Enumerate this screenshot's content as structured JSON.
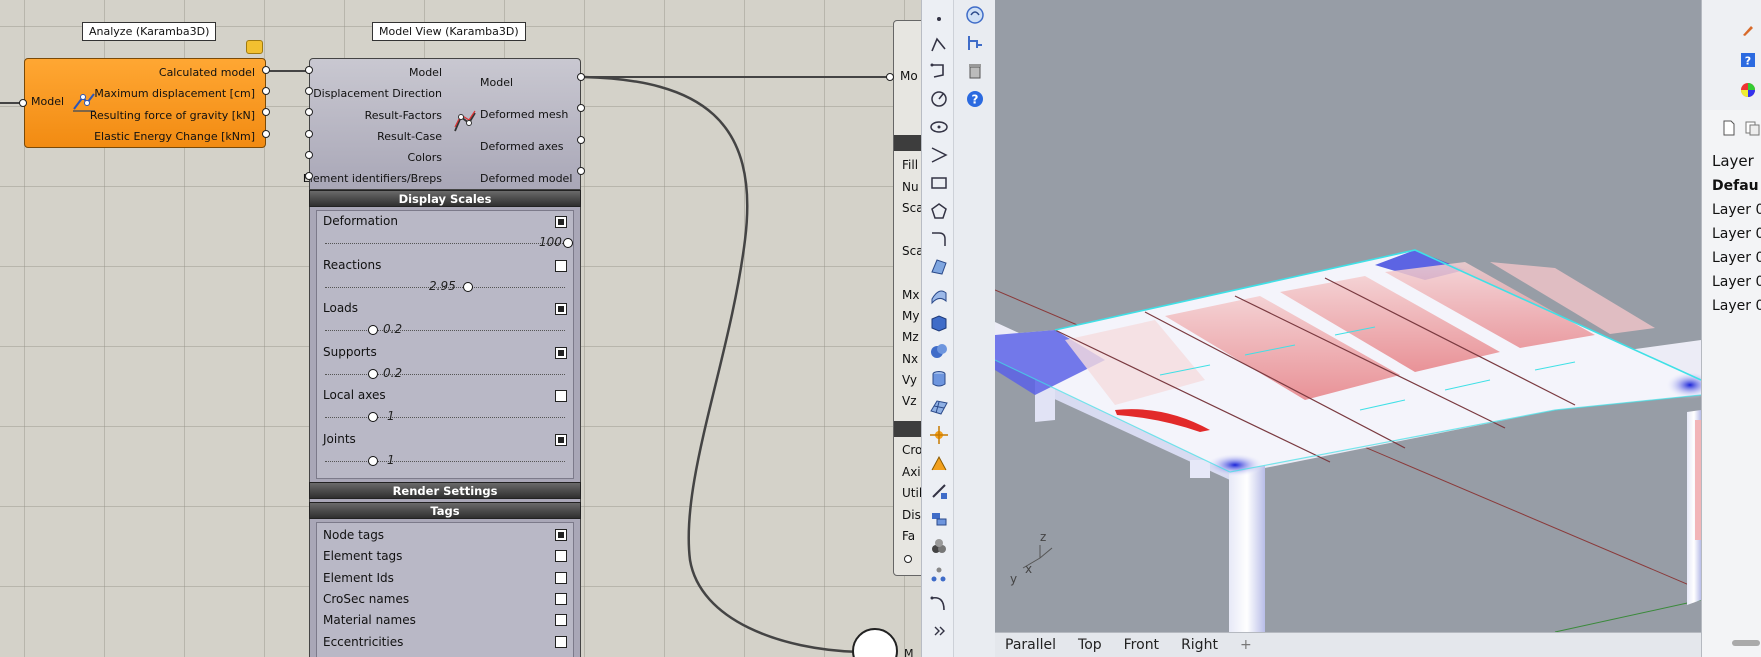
{
  "gh": {
    "analyze": {
      "title": "Analyze (Karamba3D)",
      "input": "Model",
      "outputs": [
        "Calculated model",
        "Maximum displacement [cm]",
        "Resulting force of gravity [kN]",
        "Elastic Energy Change [kNm]"
      ]
    },
    "modelview": {
      "title": "Model View (Karamba3D)",
      "inputs": [
        "Model",
        "Displacement Direction",
        "Result-Factors",
        "Result-Case",
        "Colors",
        "Element identifiers/Breps"
      ],
      "outputs": [
        "Model",
        "Deformed mesh",
        "Deformed axes",
        "Deformed model"
      ]
    },
    "display_scales": {
      "title": "Display Scales",
      "rows": [
        {
          "label": "Deformation",
          "checked": true,
          "value": "100",
          "fraction": 0.96
        },
        {
          "label": "Reactions",
          "checked": false,
          "value": "2.95",
          "fraction": 0.54
        },
        {
          "label": "Loads",
          "checked": true,
          "value": "0.2",
          "fraction": 0.18
        },
        {
          "label": "Supports",
          "checked": true,
          "value": "0.2",
          "fraction": 0.18
        },
        {
          "label": "Local axes",
          "checked": false,
          "value": "1",
          "fraction": 0.18
        },
        {
          "label": "Joints",
          "checked": true,
          "value": "1",
          "fraction": 0.18
        }
      ]
    },
    "render_settings": {
      "title": "Render Settings"
    },
    "tags": {
      "title": "Tags",
      "rows": [
        {
          "label": "Node tags",
          "checked": true
        },
        {
          "label": "Element tags",
          "checked": false
        },
        {
          "label": "Element Ids",
          "checked": false
        },
        {
          "label": "CroSec names",
          "checked": false
        },
        {
          "label": "Material names",
          "checked": false
        },
        {
          "label": "Eccentricities",
          "checked": false
        }
      ]
    },
    "side_panel": {
      "input_label": "Mo",
      "rows_a": [
        "Fill",
        "Nu",
        "Sca",
        "Sca"
      ],
      "rows_b": [
        "Mx",
        "My",
        "Mz",
        "Nx",
        "Vy",
        "Vz"
      ],
      "rows_c": [
        "Cro",
        "Axi",
        "Util",
        "Dis",
        "Fa"
      ]
    },
    "bottom_label": "M"
  },
  "rhino": {
    "view_tabs": [
      "Parallel",
      "Top",
      "Front",
      "Right"
    ],
    "add_tab": "+",
    "axis_labels": {
      "x": "x",
      "y": "y",
      "z": "z"
    },
    "layers": {
      "header": "Layer",
      "items": [
        "Defau",
        "Layer 0",
        "Layer 0",
        "Layer 0",
        "Layer 0",
        "Layer 0"
      ]
    }
  },
  "colors": {
    "analyze_fill": "#f7991e",
    "viewport_bg": "#979da6",
    "deform_red": "#e84040",
    "deform_blue": "#2030d8",
    "edge_cyan": "#3fe0e6"
  }
}
